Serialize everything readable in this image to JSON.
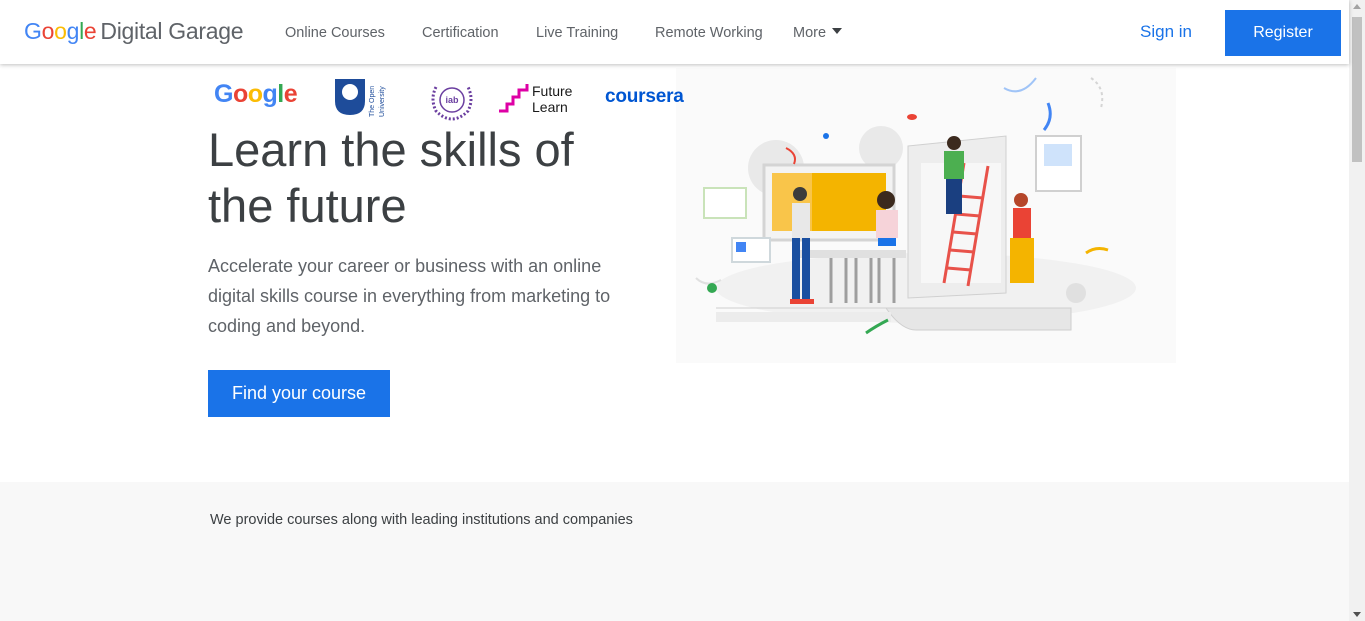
{
  "header": {
    "logo_google": "Google",
    "logo_product": "Digital Garage",
    "nav": [
      {
        "label": "Online Courses"
      },
      {
        "label": "Certification"
      },
      {
        "label": "Live Training"
      },
      {
        "label": "Remote Working"
      },
      {
        "label": "More"
      }
    ],
    "sign_in": "Sign in",
    "register": "Register"
  },
  "hero": {
    "title": "Learn the skills of the future",
    "subtitle": "Accelerate your career or business with an online digital skills course in everything from marketing to coding and beyond.",
    "cta": "Find your course",
    "illustration_icon": "people-learning-illustration"
  },
  "partners": {
    "intro": "We provide courses along with leading institutions and companies",
    "logos": [
      {
        "name": "Google",
        "icon": "google-logo"
      },
      {
        "name": "The Open University",
        "icon": "open-university-logo"
      },
      {
        "name": "iab",
        "icon": "iab-logo"
      },
      {
        "name": "Future Learn",
        "icon": "futurelearn-logo"
      },
      {
        "name": "coursera",
        "icon": "coursera-logo"
      }
    ]
  },
  "colors": {
    "primary_blue": "#1a73e8",
    "google_blue": "#4285f4",
    "google_red": "#ea4335",
    "google_yellow": "#fbbc05",
    "google_green": "#34a853",
    "coursera_blue": "#0056d2",
    "futurelearn_pink": "#de00a5",
    "open_university_blue": "#1e4c9a",
    "iab_purple": "#6b3fa0"
  }
}
